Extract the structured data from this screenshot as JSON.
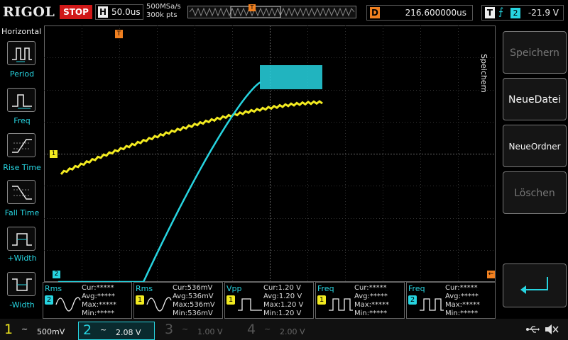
{
  "header": {
    "logo": "RIGOL",
    "run_status": "STOP",
    "timebase_label": "H",
    "timebase": "50.0us",
    "sample_rate": "500MSa/s",
    "memory_depth": "300k pts",
    "delay_label": "D",
    "delay": "216.600000us",
    "trigger_label": "T",
    "trigger_source": "2",
    "trigger_level": "-21.9 V",
    "trigger_marker": "T"
  },
  "left_menu": {
    "title": "Horizontal",
    "items": [
      {
        "label": "Period",
        "icon": "period-icon"
      },
      {
        "label": "Freq",
        "icon": "frequency-icon"
      },
      {
        "label": "Rise Time",
        "icon": "rise-time-icon"
      },
      {
        "label": "Fall Time",
        "icon": "fall-time-icon"
      },
      {
        "label": "+Width",
        "icon": "positive-width-icon"
      },
      {
        "label": "-Width",
        "icon": "negative-width-icon"
      }
    ]
  },
  "right_menu": {
    "title": "Speichern",
    "buttons": [
      {
        "label": "Speichern",
        "enabled": false
      },
      {
        "label": "NeueDatei",
        "enabled": true
      },
      {
        "label": "NeueOrdner",
        "enabled": true
      },
      {
        "label": "Löschen",
        "enabled": false
      }
    ],
    "back_icon": "return-arrow-icon"
  },
  "screen": {
    "trigger_pos_marker": "T",
    "ch1_marker": "1",
    "ch2_marker": "2",
    "trig_level_marker": "←"
  },
  "measurements": [
    {
      "name": "Rms",
      "channel": "2",
      "channel_color": "#27d4e0",
      "icon": "sine-wave-icon",
      "stats": [
        "Cur:*****",
        "Avg:*****",
        "Max:*****",
        "Min:*****"
      ]
    },
    {
      "name": "Rms",
      "channel": "1",
      "channel_color": "#f2ea20",
      "icon": "sine-wave-icon",
      "stats": [
        "Cur:536mV",
        "Avg:536mV",
        "Max:536mV",
        "Min:536mV"
      ]
    },
    {
      "name": "Vpp",
      "channel": "1",
      "channel_color": "#f2ea20",
      "icon": "pulse-wave-icon",
      "stats": [
        "Cur:1.20 V",
        "Avg:1.20 V",
        "Max:1.20 V",
        "Min:1.20 V"
      ]
    },
    {
      "name": "Freq",
      "channel": "1",
      "channel_color": "#f2ea20",
      "icon": "frequency-wave-icon",
      "stats": [
        "Cur:*****",
        "Avg:*****",
        "Max:*****",
        "Min:*****"
      ]
    },
    {
      "name": "Freq",
      "channel": "2",
      "channel_color": "#27d4e0",
      "icon": "frequency-wave-icon",
      "stats": [
        "Cur:*****",
        "Avg:*****",
        "Max:*****",
        "Min:*****"
      ]
    }
  ],
  "channels": [
    {
      "num": "1",
      "coupling": "~",
      "scale": "500mV",
      "color": "#f2ea20",
      "active": false
    },
    {
      "num": "2",
      "coupling": "~",
      "scale": "2.08 V",
      "color": "#27d4e0",
      "active": true
    },
    {
      "num": "3",
      "coupling": "~",
      "scale": "1.00 V",
      "color": "#b030b0",
      "active": false
    },
    {
      "num": "4",
      "coupling": "~",
      "scale": "2.00 V",
      "color": "#4060e0",
      "active": false
    }
  ],
  "colors": {
    "ch1": "#f2ea20",
    "ch2": "#27d4e0",
    "trigger": "#f08020",
    "stop": "#d01818"
  }
}
